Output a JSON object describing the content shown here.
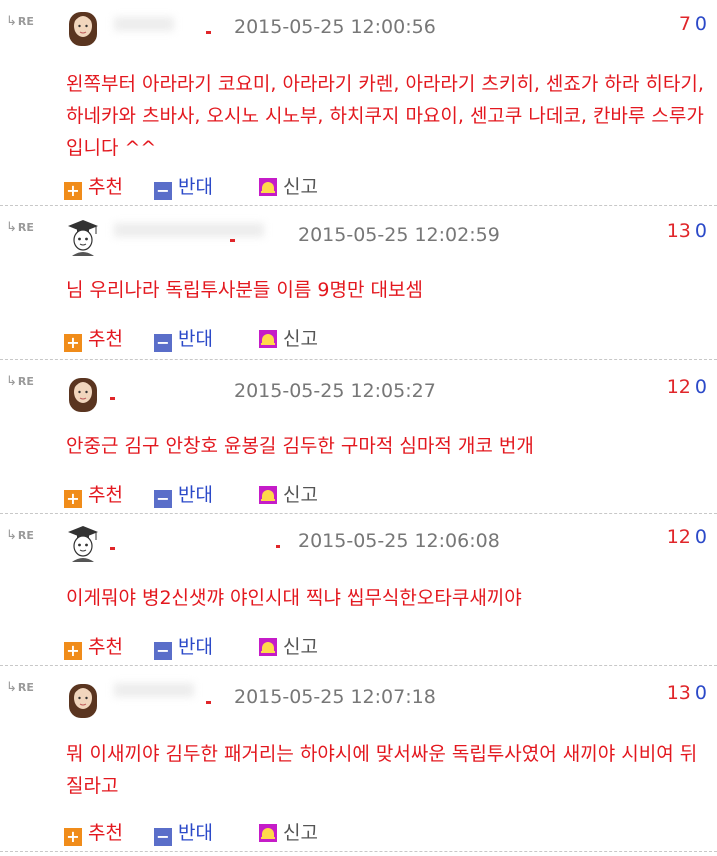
{
  "labels": {
    "re": "RE",
    "recommend": "추천",
    "oppose": "반대",
    "report": "신고"
  },
  "comments": [
    {
      "date": "2015-05-25 12:00:56",
      "up": "7",
      "down": "0",
      "text": "왼쪽부터 아라라기 코요미, 아라라기 카렌, 아라라기 츠키히, 센죠가 하라 히타기, 하네카와 츠바사, 오시노 시노부, 하치쿠지 마요이, 센고쿠 나데코, 칸바루 스루가 입니다 ^^",
      "avatar": "girl-avatar-icon"
    },
    {
      "date": "2015-05-25 12:02:59",
      "up": "13",
      "down": "0",
      "text": "님 우리나라 독립투사분들 이름 9명만 대보셈",
      "avatar": "graduate-avatar-icon"
    },
    {
      "date": "2015-05-25 12:05:27",
      "up": "12",
      "down": "0",
      "text": "안중근 김구 안창호 윤봉길 김두한 구마적 심마적 개코 번개",
      "avatar": "girl-avatar-icon"
    },
    {
      "date": "2015-05-25 12:06:08",
      "up": "12",
      "down": "0",
      "text": "이게뭐야 병2신샛꺄 야인시대 찍냐 씹무식한오타쿠새끼야",
      "avatar": "graduate-avatar-icon"
    },
    {
      "date": "2015-05-25 12:07:18",
      "up": "13",
      "down": "0",
      "text": "뭐 이새끼야 김두한 패거리는 하야시에 맞서싸운 독립투사였어 새끼야 시비여 뒤질라고",
      "avatar": "girl-avatar-icon"
    }
  ],
  "colors": {
    "text": "#e3181f",
    "up": "#e0262a",
    "down": "#2b49c8",
    "date": "#777777"
  }
}
